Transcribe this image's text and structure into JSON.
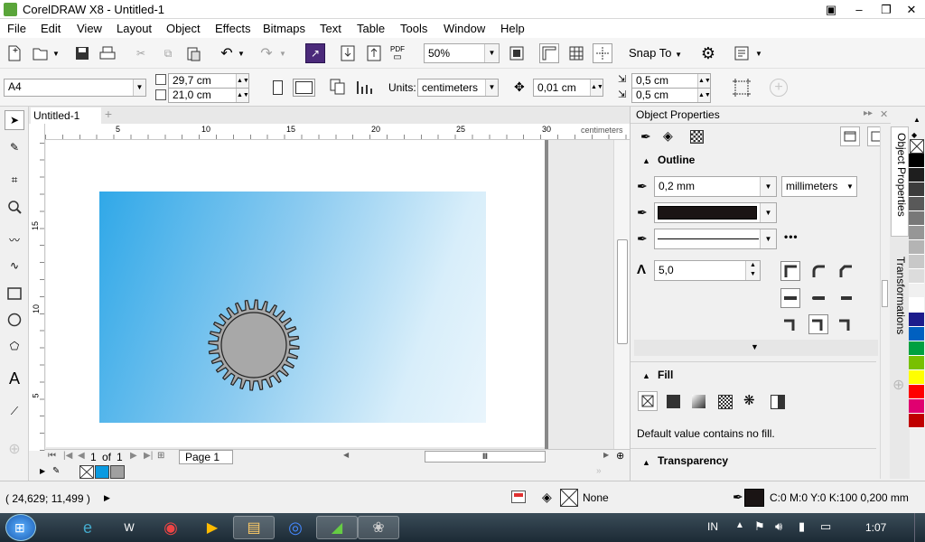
{
  "window": {
    "title": "CorelDRAW X8 - Untitled-1"
  },
  "menu": [
    "File",
    "Edit",
    "View",
    "Layout",
    "Object",
    "Effects",
    "Bitmaps",
    "Text",
    "Table",
    "Tools",
    "Window",
    "Help"
  ],
  "toolbar": {
    "zoom": "50%",
    "snap_to": "Snap To",
    "pdf_label": "PDF"
  },
  "propbar": {
    "page_size": "A4",
    "width": "29,7 cm",
    "height": "21,0 cm",
    "units_label": "Units:",
    "units": "centimeters",
    "nudge": "0,01 cm",
    "dup_x": "0,5 cm",
    "dup_y": "0,5 cm"
  },
  "doc_tab": "Untitled-1",
  "rulers": {
    "unit": "centimeters",
    "h_ticks": [
      "5",
      "10",
      "15",
      "20",
      "25",
      "30"
    ],
    "v_ticks": [
      "15",
      "10",
      "5"
    ]
  },
  "pager": {
    "current": "1",
    "of": "of",
    "total": "1",
    "page_tab": "Page 1"
  },
  "dock": {
    "title": "Object Properties",
    "outline": {
      "header": "Outline",
      "width": "0,2 mm",
      "units": "millimeters",
      "miter": "5,0",
      "color": "#1a1414"
    },
    "fill": {
      "header": "Fill",
      "desc": "Default value contains no fill."
    },
    "transparency": {
      "header": "Transparency"
    }
  },
  "side_tabs": [
    "Object Properties",
    "Transformations"
  ],
  "palette": [
    "#000000",
    "#1e1e1e",
    "#3c3c3c",
    "#595959",
    "#787878",
    "#969696",
    "#b4b4b4",
    "#c8c8c8",
    "#dcdcdc",
    "#f0f0f0",
    "#ffffff",
    "#1c1c8c",
    "#0060c0",
    "#00a040",
    "#78c000",
    "#ffff00",
    "#ff0000",
    "#e00070",
    "#c00000"
  ],
  "doc_palette": [
    "#0a9ae0",
    "#a0a0a0"
  ],
  "status": {
    "coords": "( 24,629; 11,499 )",
    "fill": "None",
    "outline_text": "C:0 M:0 Y:0 K:100  0,200 mm"
  },
  "taskbar": {
    "lang": "IN",
    "time": "1:07"
  }
}
